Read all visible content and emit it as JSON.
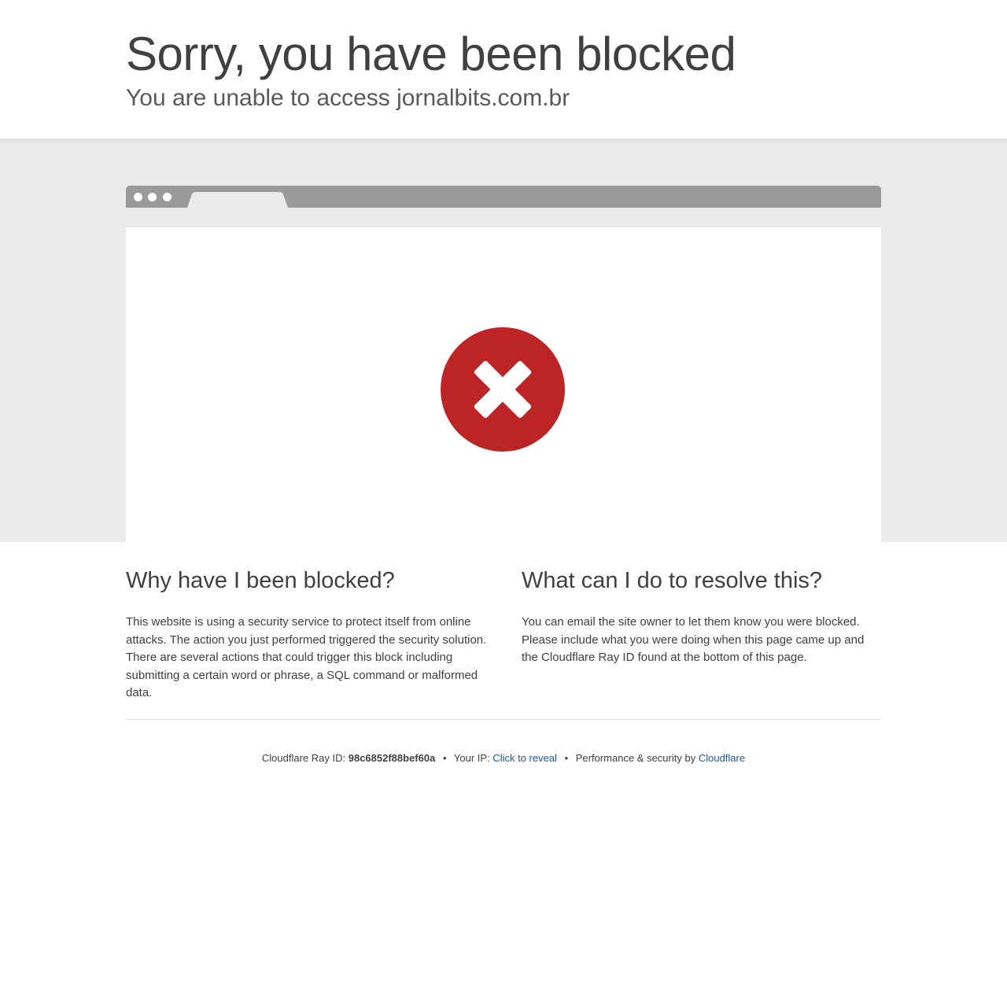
{
  "header": {
    "headline": "Sorry, you have been blocked",
    "subheadline": "You are unable to access jornalbits.com.br"
  },
  "illustration": {
    "icon": "error-x-icon",
    "icon_color": "#bd2426",
    "bar_color": "#9b9b9b",
    "band_color": "#ebebeb"
  },
  "why": {
    "heading": "Why have I been blocked?",
    "body": "This website is using a security service to protect itself from online attacks. The action you just performed triggered the security solution. There are several actions that could trigger this block including submitting a certain word or phrase, a SQL command or malformed data."
  },
  "resolve": {
    "heading": "What can I do to resolve this?",
    "body": "You can email the site owner to let them know you were blocked. Please include what you were doing when this page came up and the Cloudflare Ray ID found at the bottom of this page."
  },
  "footer": {
    "ray_label": "Cloudflare Ray ID:",
    "ray_id": "98c6852f88bef60a",
    "separator": "•",
    "ip_label": "Your IP:",
    "ip_link": "Click to reveal",
    "perf_label": "Performance & security by",
    "cloudflare_link": "Cloudflare",
    "link_color": "#1a56a8"
  }
}
